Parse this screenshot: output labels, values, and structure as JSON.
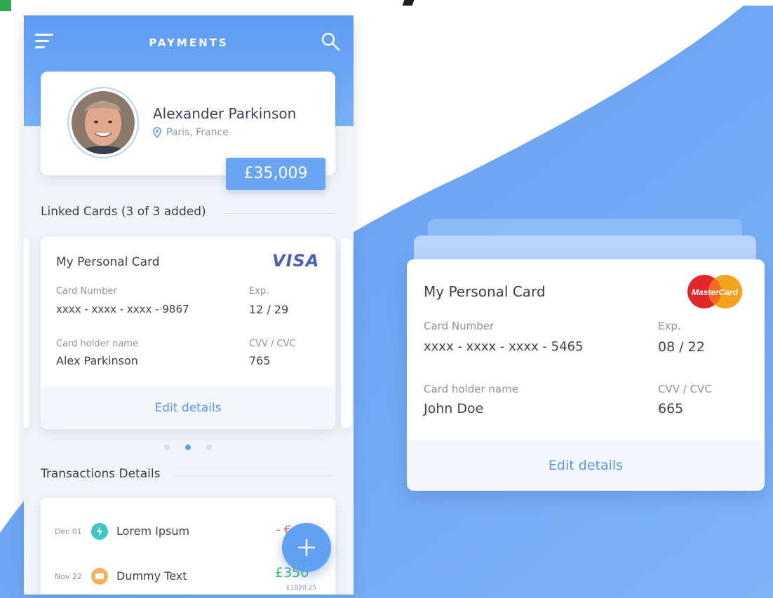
{
  "colors": {
    "accent_blue": "#62a0f2",
    "background_blue": "#6aa5f3",
    "negative": "#ef5b5b",
    "positive": "#3fba6a",
    "visa": "#4c5fb0"
  },
  "phone": {
    "title": "PAYMENTS",
    "icons": [
      "hamburger-menu-icon",
      "search-icon"
    ]
  },
  "profile": {
    "name": "Alexander Parkinson",
    "location": "Paris, France",
    "balance": "£35,009"
  },
  "linked_cards": {
    "section_title": "Linked Cards (3 of 3 added)",
    "active_page": 2,
    "page_count": 3,
    "card": {
      "title": "My Personal Card",
      "brand": "VISA",
      "card_number_label": "Card Number",
      "card_number": "xxxx - xxxx - xxxx - 9867",
      "exp_label": "Exp.",
      "exp": "12 / 29",
      "holder_label": "Card holder name",
      "holder": "Alex Parkinson",
      "cvv_label": "CVV / CVC",
      "cvv": "765",
      "edit_label": "Edit details"
    }
  },
  "transactions": {
    "section_title": "Transactions Details",
    "items": [
      {
        "date": "Dec 01",
        "label": "Lorem Ipsum",
        "amount": "- €",
        "icon": "lightning-icon",
        "icon_color": "#3ec6c0"
      },
      {
        "date": "Nov 22",
        "label": "Dummy Text",
        "amount": "£350",
        "sub": "£1820.25",
        "icon": "card-icon",
        "icon_color": "#f6b35a"
      }
    ]
  },
  "fab": {
    "icon": "plus-icon"
  },
  "big_card": {
    "title": "My Personal Card",
    "brand": "MasterCard",
    "card_number_label": "Card Number",
    "card_number": "xxxx - xxxx - xxxx - 5465",
    "exp_label": "Exp.",
    "exp": "08 / 22",
    "holder_label": "Card holder name",
    "holder": "John Doe",
    "cvv_label": "CVV / CVC",
    "cvv": "665",
    "edit_label": "Edit details"
  }
}
